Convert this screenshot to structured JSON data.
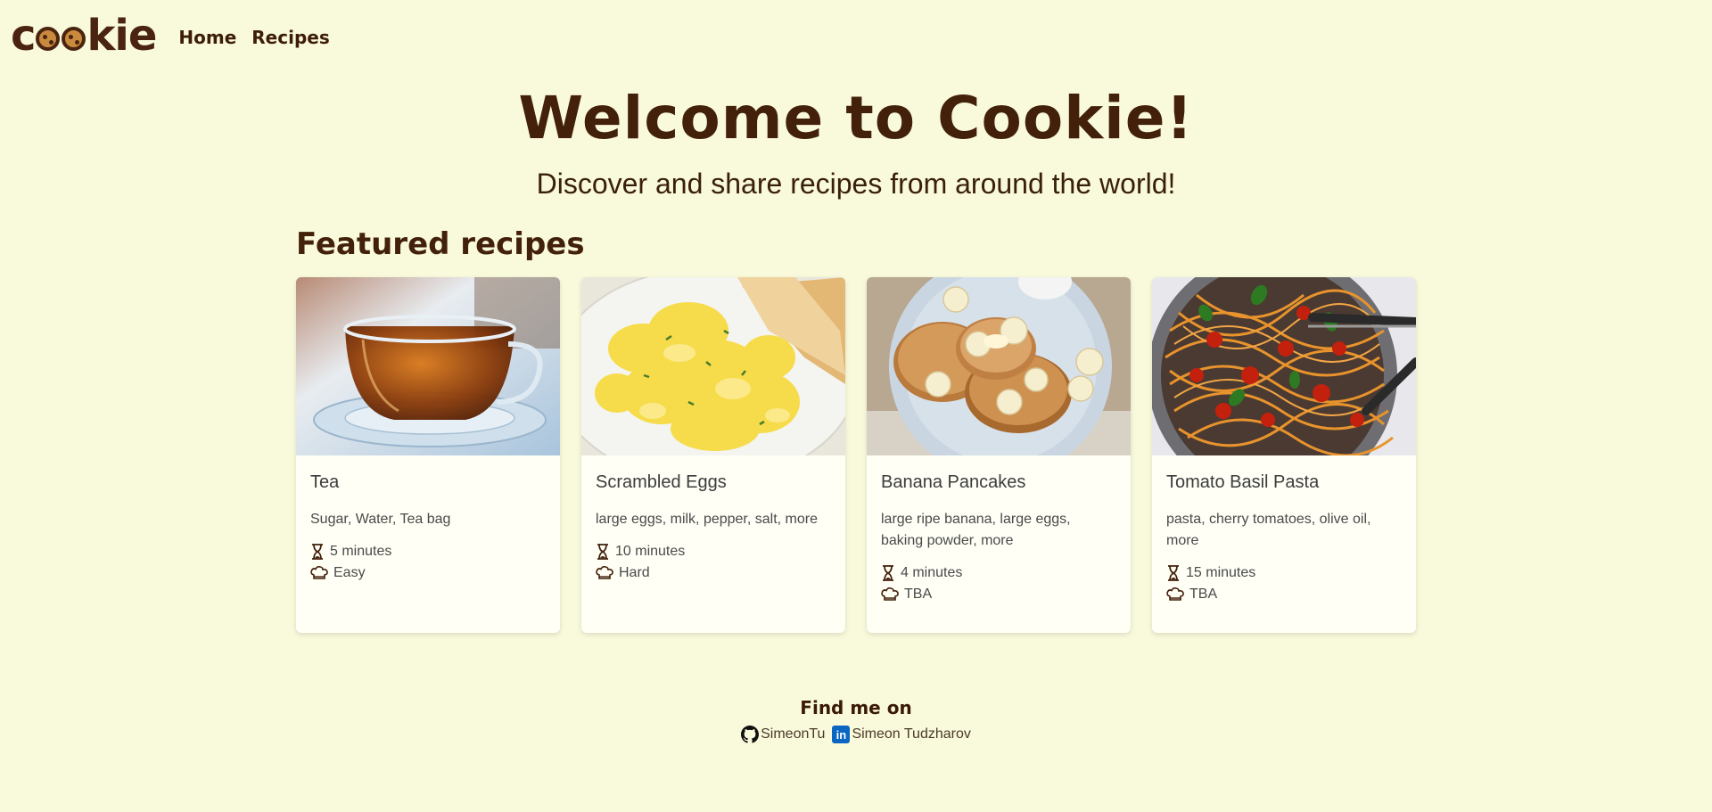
{
  "brand": {
    "logo_text_before": "c",
    "logo_text_after": "kie",
    "icon": "cookie-icon"
  },
  "nav": {
    "items": [
      {
        "label": "Home"
      },
      {
        "label": "Recipes"
      }
    ]
  },
  "hero": {
    "title": "Welcome to Cookie!",
    "subtitle": "Discover and share recipes from around the world!"
  },
  "featured": {
    "title": "Featured recipes",
    "recipes": [
      {
        "name": "Tea",
        "ingredients": "Sugar, Water, Tea bag",
        "time": "5 minutes",
        "difficulty": "Easy",
        "image": "tea-cup-photo"
      },
      {
        "name": "Scrambled Eggs",
        "ingredients": "large eggs, milk, pepper, salt, more",
        "time": "10 minutes",
        "difficulty": "Hard",
        "image": "scrambled-eggs-photo"
      },
      {
        "name": "Banana Pancakes",
        "ingredients": "large ripe banana, large eggs, baking powder, more",
        "time": "4 minutes",
        "difficulty": "TBA",
        "image": "banana-pancakes-photo"
      },
      {
        "name": "Tomato Basil Pasta",
        "ingredients": "pasta, cherry tomatoes, olive oil, more",
        "time": "15 minutes",
        "difficulty": "TBA",
        "image": "tomato-basil-pasta-photo"
      }
    ],
    "time_icon": "hourglass-icon",
    "difficulty_icon": "chef-hat-icon"
  },
  "footer": {
    "title": "Find me on",
    "links": [
      {
        "label": "SimeonTu",
        "icon": "github-icon"
      },
      {
        "label": "Simeon Tudzharov",
        "icon": "linkedin-icon",
        "icon_text": "in"
      }
    ]
  },
  "colors": {
    "background": "#f9f9db",
    "brand_brown": "#42200a",
    "card_background": "#fffff6",
    "linkedin_blue": "#0a66c2"
  }
}
